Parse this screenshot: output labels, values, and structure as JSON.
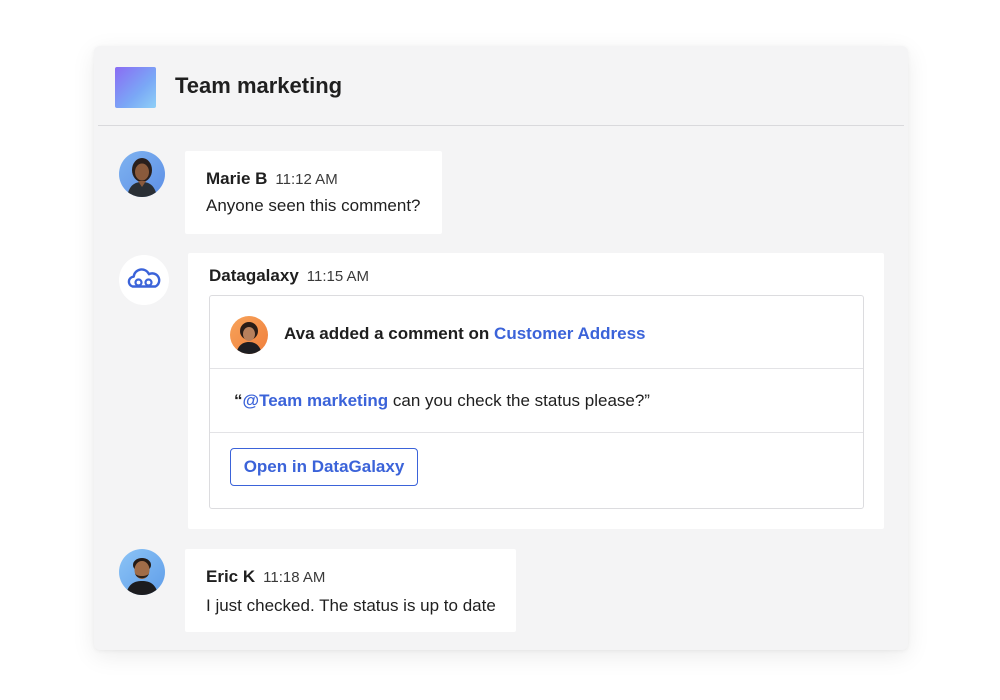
{
  "channel": {
    "title": "Team marketing"
  },
  "messages": [
    {
      "author": "Marie B",
      "time": "11:12 AM",
      "text": "Anyone seen this comment?"
    },
    {
      "author": "Eric K",
      "time": "11:18 AM",
      "text": "I just checked. The status is up to date"
    }
  ],
  "bot": {
    "name": "Datagalaxy",
    "time": "11:15 AM",
    "card": {
      "notif_prefix": "Ava added a comment on",
      "notif_link": "Customer Address",
      "quote_open": "“",
      "quote_mention": "@Team marketing",
      "quote_rest": " can you check the status please?”",
      "button_label": "Open in DataGalaxy"
    }
  },
  "colors": {
    "accent": "#3b63d9",
    "card_bg": "#f4f4f5",
    "bubble_bg": "#ffffff"
  },
  "icons": {
    "bot": "cloud-icon",
    "channel": "channel-gradient-icon"
  }
}
